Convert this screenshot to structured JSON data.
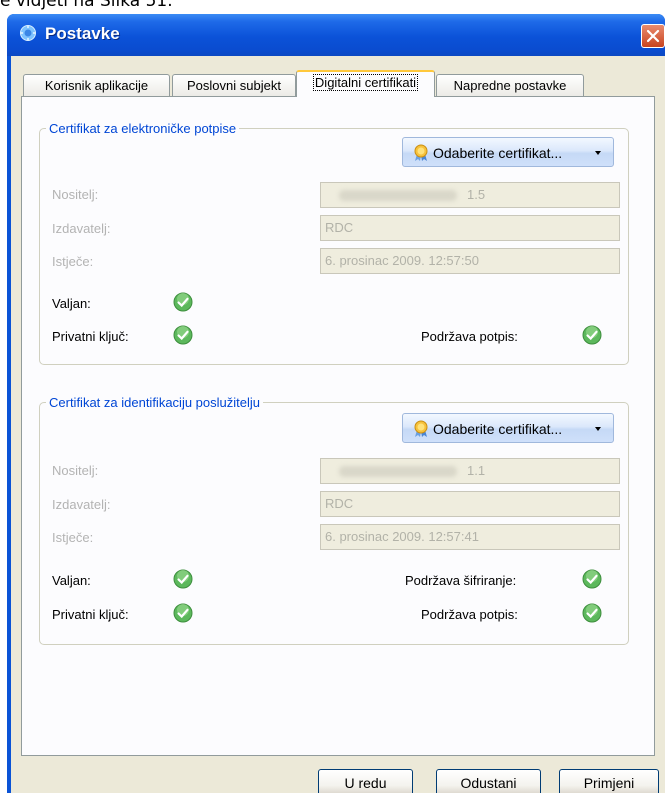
{
  "caption": "e vidjeti na Slika 51.",
  "window": {
    "title": "Postavke"
  },
  "tabs": [
    {
      "label": "Korisnik aplikacije"
    },
    {
      "label": "Poslovni subjekt"
    },
    {
      "label": "Digitalni certifikati",
      "active": true
    },
    {
      "label": "Napredne postavke"
    }
  ],
  "signing": {
    "legend": "Certifikat za elektroničke potpise",
    "select_button": "Odaberite certifikat...",
    "holder_label": "Nositelj:",
    "holder_value": "1.5",
    "issuer_label": "Izdavatelj:",
    "issuer_value": "RDC",
    "expires_label": "Istječe:",
    "expires_value": "6. prosinac 2009. 12:57:50",
    "valid_label": "Valjan:",
    "private_key_label": "Privatni ključ:",
    "supports_signature_label": "Podržava potpis:"
  },
  "identification": {
    "legend": "Certifikat za identifikaciju poslužitelju",
    "select_button": "Odaberite certifikat...",
    "holder_label": "Nositelj:",
    "holder_value": "1.1",
    "issuer_label": "Izdavatelj:",
    "issuer_value": "RDC",
    "expires_label": "Istječe:",
    "expires_value": "6. prosinac 2009. 12:57:41",
    "valid_label": "Valjan:",
    "private_key_label": "Privatni ključ:",
    "supports_encryption_label": "Podržava šifriranje:",
    "supports_signature_label": "Podržava potpis:"
  },
  "footer": {
    "ok": "U redu",
    "cancel": "Odustani",
    "apply": "Primjeni"
  },
  "icons": {
    "app": "gear-globe-icon",
    "close": "close-icon",
    "certificate": "award-ribbon-icon",
    "status": "green-check-icon"
  },
  "colors": {
    "titlebar": "#0a53d6",
    "dialog_bg": "#ece9d8",
    "legend": "#0046d5",
    "check": "#5cb85c",
    "close": "#c8431f"
  }
}
